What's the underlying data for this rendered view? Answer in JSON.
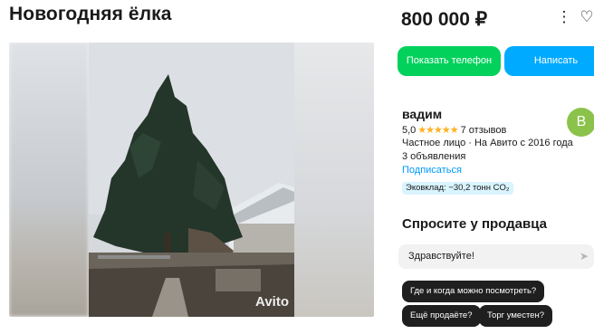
{
  "listing": {
    "title": "Новогодняя ёлка",
    "price": "800 000 ₽",
    "watermark": "Avito"
  },
  "actions": {
    "show_phone": "Показать телефон",
    "write": "Написать"
  },
  "seller": {
    "name": "вадим",
    "avatar_letter": "В",
    "rating": "5,0",
    "stars": "★★★★★",
    "reviews": "7 отзывов",
    "since": "Частное лицо · На Авито с 2016 года",
    "listings": "3 объявления",
    "subscribe": "Подписаться",
    "eco": "Эковклад: −30,2 тонн CO₂"
  },
  "ask": {
    "title": "Спросите у продавца",
    "message": "Здравствуйте!",
    "questions": [
      "Где и когда можно посмотреть?",
      "Ещё продаёте?",
      "Торг уместен?"
    ]
  },
  "colors": {
    "phone": "#02d15c",
    "write": "#00aaff",
    "link": "#0099f7",
    "star": "#ffb021"
  },
  "icons": {
    "share": "share-icon",
    "favorite": "heart-icon",
    "send": "send-icon"
  }
}
